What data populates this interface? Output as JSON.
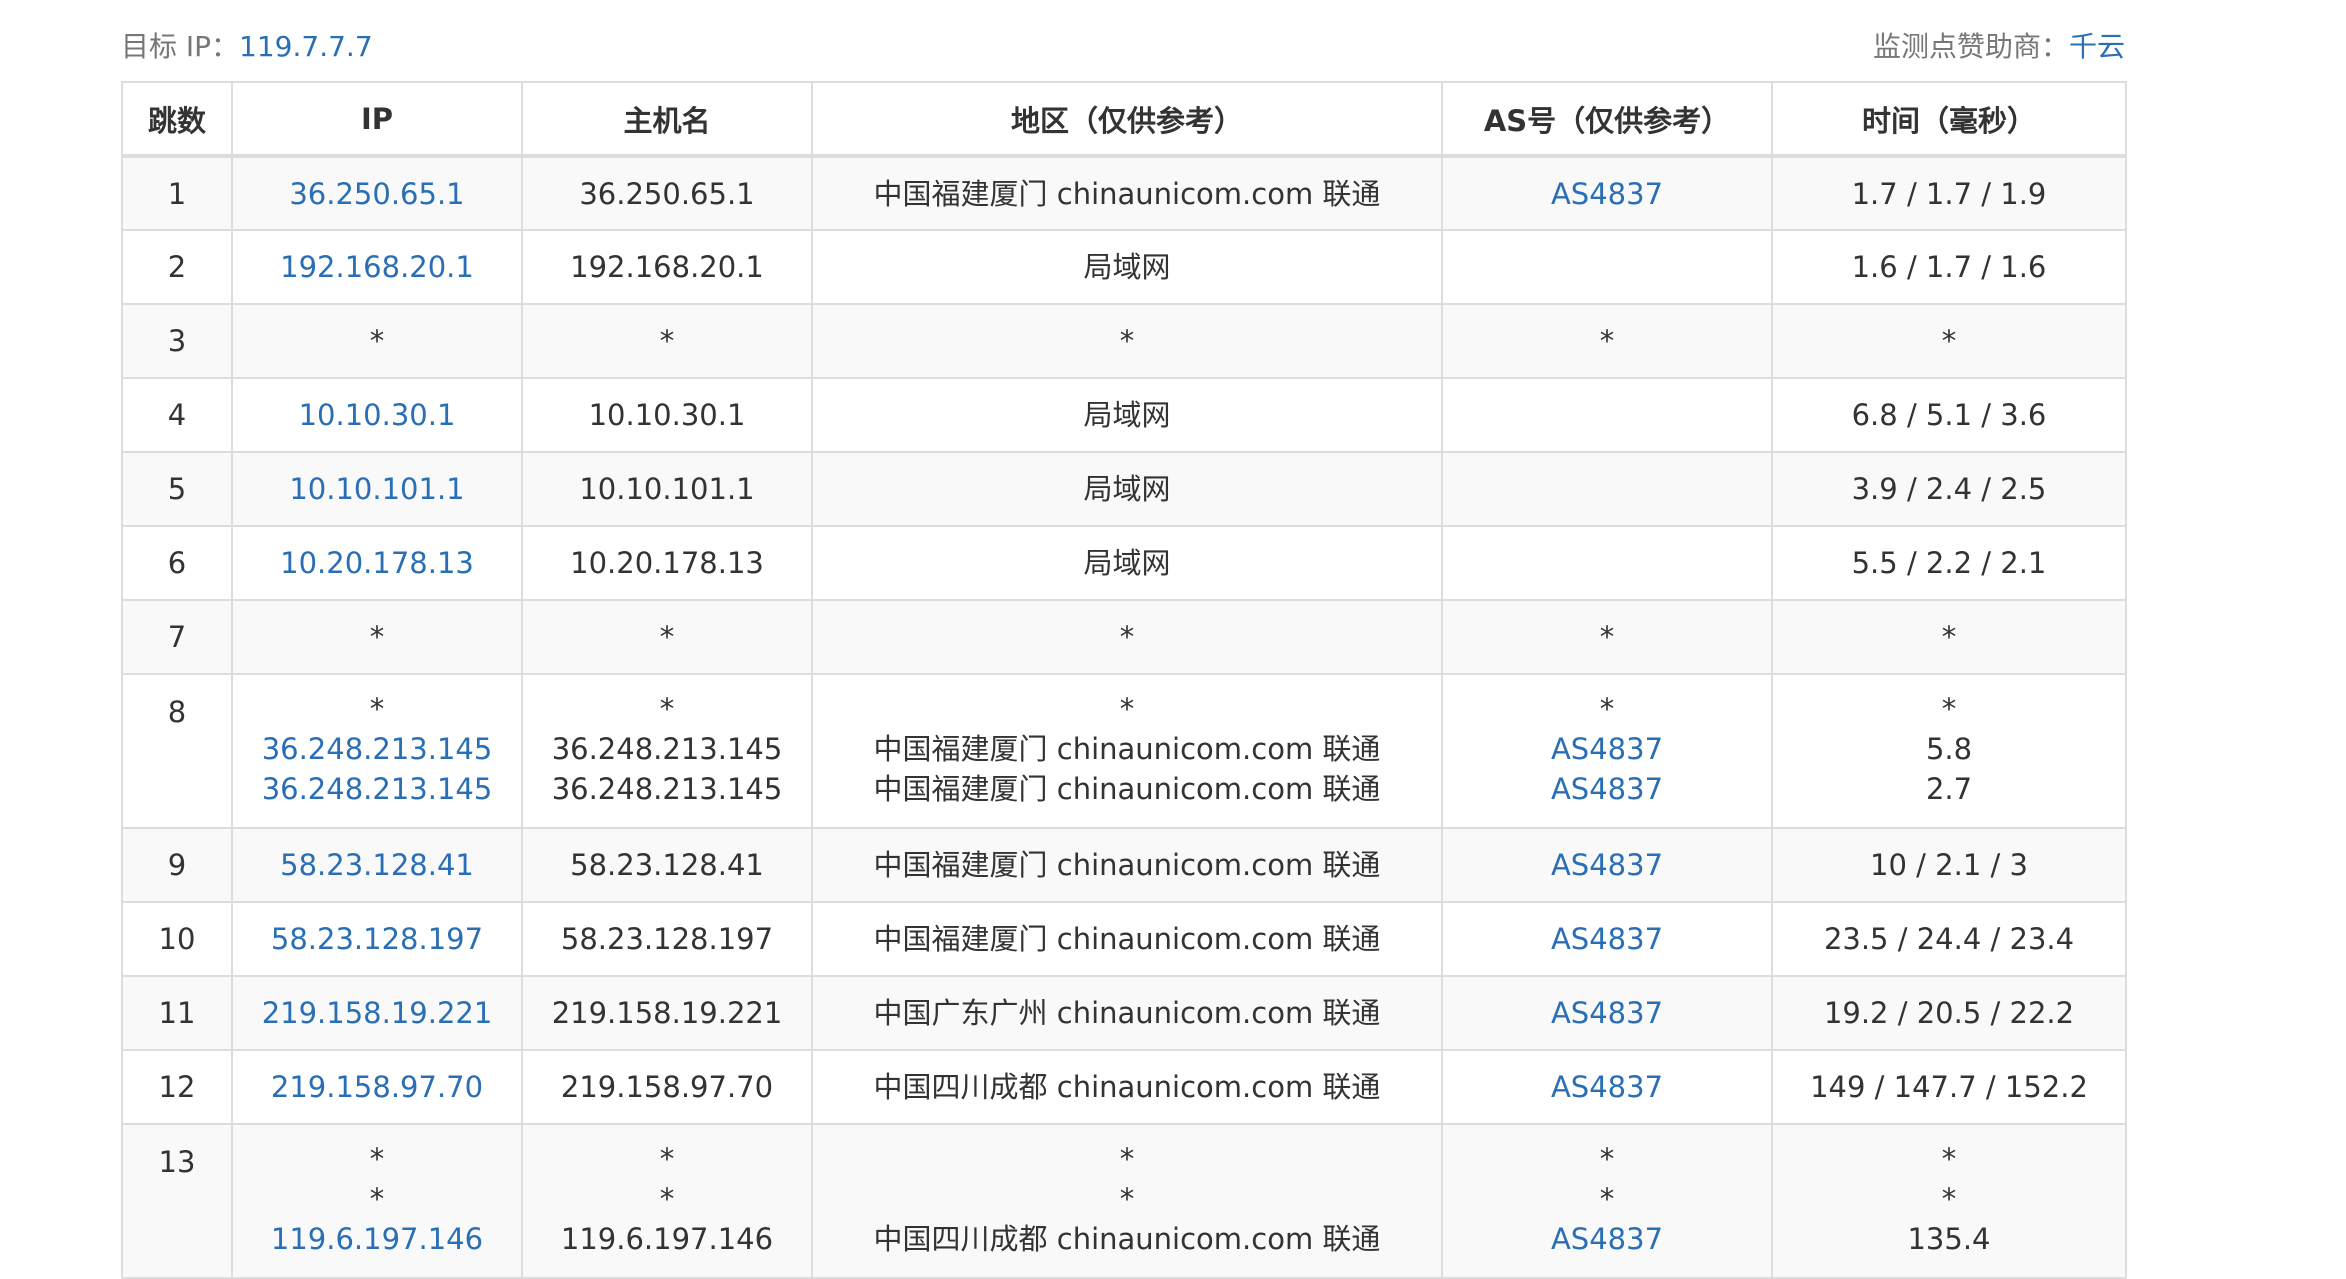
{
  "header": {
    "target_label": "目标 IP：",
    "target_ip": "119.7.7.7",
    "sponsor_label": "监测点赞助商：",
    "sponsor_name": "千云"
  },
  "table": {
    "columns": [
      "跳数",
      "IP",
      "主机名",
      "地区（仅供参考）",
      "AS号（仅供参考）",
      "时间（毫秒）"
    ],
    "rows": [
      {
        "hop": "1",
        "ip": [
          "36.250.65.1"
        ],
        "host": [
          "36.250.65.1"
        ],
        "region": [
          "中国福建厦门 chinaunicom.com 联通"
        ],
        "as": [
          "AS4837"
        ],
        "time": [
          "1.7 / 1.7 / 1.9"
        ]
      },
      {
        "hop": "2",
        "ip": [
          "192.168.20.1"
        ],
        "host": [
          "192.168.20.1"
        ],
        "region": [
          "局域网"
        ],
        "as": [
          ""
        ],
        "time": [
          "1.6 / 1.7 / 1.6"
        ]
      },
      {
        "hop": "3",
        "ip": [
          "*"
        ],
        "host": [
          "*"
        ],
        "region": [
          "*"
        ],
        "as": [
          "*"
        ],
        "time": [
          "*"
        ]
      },
      {
        "hop": "4",
        "ip": [
          "10.10.30.1"
        ],
        "host": [
          "10.10.30.1"
        ],
        "region": [
          "局域网"
        ],
        "as": [
          ""
        ],
        "time": [
          "6.8 / 5.1 / 3.6"
        ]
      },
      {
        "hop": "5",
        "ip": [
          "10.10.101.1"
        ],
        "host": [
          "10.10.101.1"
        ],
        "region": [
          "局域网"
        ],
        "as": [
          ""
        ],
        "time": [
          "3.9 / 2.4 / 2.5"
        ]
      },
      {
        "hop": "6",
        "ip": [
          "10.20.178.13"
        ],
        "host": [
          "10.20.178.13"
        ],
        "region": [
          "局域网"
        ],
        "as": [
          ""
        ],
        "time": [
          "5.5 / 2.2 / 2.1"
        ]
      },
      {
        "hop": "7",
        "ip": [
          "*"
        ],
        "host": [
          "*"
        ],
        "region": [
          "*"
        ],
        "as": [
          "*"
        ],
        "time": [
          "*"
        ]
      },
      {
        "hop": "8",
        "ip": [
          "*",
          "36.248.213.145",
          "36.248.213.145"
        ],
        "host": [
          "*",
          "36.248.213.145",
          "36.248.213.145"
        ],
        "region": [
          "*",
          "中国福建厦门 chinaunicom.com 联通",
          "中国福建厦门 chinaunicom.com 联通"
        ],
        "as": [
          "*",
          "AS4837",
          "AS4837"
        ],
        "time": [
          "*",
          "5.8",
          "2.7"
        ]
      },
      {
        "hop": "9",
        "ip": [
          "58.23.128.41"
        ],
        "host": [
          "58.23.128.41"
        ],
        "region": [
          "中国福建厦门 chinaunicom.com 联通"
        ],
        "as": [
          "AS4837"
        ],
        "time": [
          "10 / 2.1 / 3"
        ]
      },
      {
        "hop": "10",
        "ip": [
          "58.23.128.197"
        ],
        "host": [
          "58.23.128.197"
        ],
        "region": [
          "中国福建厦门 chinaunicom.com 联通"
        ],
        "as": [
          "AS4837"
        ],
        "time": [
          "23.5 / 24.4 / 23.4"
        ]
      },
      {
        "hop": "11",
        "ip": [
          "219.158.19.221"
        ],
        "host": [
          "219.158.19.221"
        ],
        "region": [
          "中国广东广州 chinaunicom.com 联通"
        ],
        "as": [
          "AS4837"
        ],
        "time": [
          "19.2 / 20.5 / 22.2"
        ]
      },
      {
        "hop": "12",
        "ip": [
          "219.158.97.70"
        ],
        "host": [
          "219.158.97.70"
        ],
        "region": [
          "中国四川成都 chinaunicom.com 联通"
        ],
        "as": [
          "AS4837"
        ],
        "time": [
          "149 / 147.7 / 152.2"
        ]
      },
      {
        "hop": "13",
        "ip": [
          "*",
          "*",
          "119.6.197.146"
        ],
        "host": [
          "*",
          "*",
          "119.6.197.146"
        ],
        "region": [
          "*",
          "*",
          "中国四川成都 chinaunicom.com 联通"
        ],
        "as": [
          "*",
          "*",
          "AS4837"
        ],
        "time": [
          "*",
          "*",
          "135.4"
        ]
      }
    ]
  },
  "colors": {
    "link": "#2a6fb5",
    "text": "#333333",
    "muted": "#777777",
    "border": "#dddddd",
    "stripe": "#f9f9f9"
  }
}
